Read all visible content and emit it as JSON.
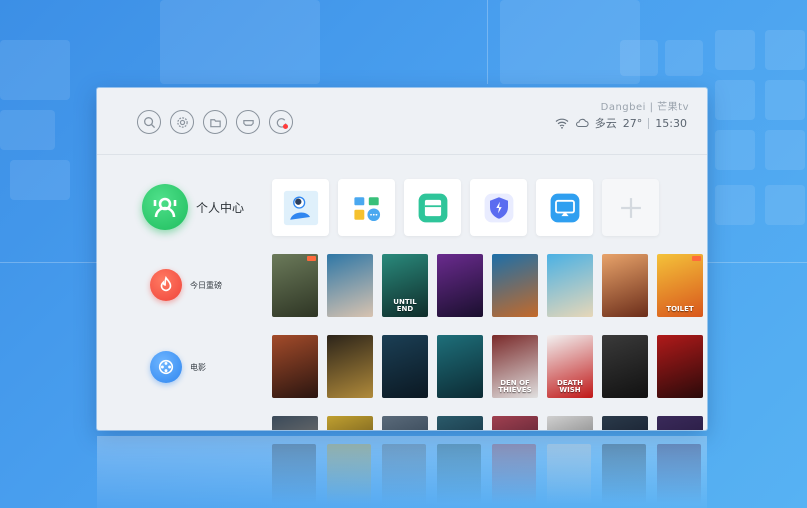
{
  "header": {
    "brand": "Dangbei | 芒果tv",
    "weather_text": "多云",
    "temperature": "27°",
    "time": "15:30"
  },
  "toolbar": {
    "icons": [
      "search-icon",
      "settings-icon",
      "folder-icon",
      "hdmi-icon",
      "record-icon"
    ]
  },
  "sidebar": {
    "user": {
      "label": "个人中心"
    },
    "items": [
      {
        "label": "今日重磅"
      },
      {
        "label": "电影"
      }
    ]
  },
  "apps": [
    {
      "name": "user-app",
      "icon": "person-icon"
    },
    {
      "name": "app-folder",
      "icon": "grid-icon"
    },
    {
      "name": "file-manager",
      "icon": "folder-green-icon"
    },
    {
      "name": "security",
      "icon": "shield-icon"
    },
    {
      "name": "screen-cast",
      "icon": "cast-icon"
    },
    {
      "name": "add-app",
      "icon": "plus-icon"
    }
  ],
  "posters": {
    "row1": [
      {
        "title": "",
        "colors": [
          "#6b7a5a",
          "#2e3524"
        ]
      },
      {
        "title": "",
        "colors": [
          "#2f77a6",
          "#d8c3b0"
        ]
      },
      {
        "title": "UNTIL END",
        "colors": [
          "#2a8a7c",
          "#0f2c2a"
        ]
      },
      {
        "title": "",
        "colors": [
          "#6a2b8e",
          "#1a0f2e"
        ]
      },
      {
        "title": "",
        "colors": [
          "#1d6fa8",
          "#c46a2a"
        ]
      },
      {
        "title": "",
        "colors": [
          "#4bb1e4",
          "#e7d7b8"
        ]
      },
      {
        "title": "",
        "colors": [
          "#e8a36a",
          "#6b2d1a"
        ]
      },
      {
        "title": "TOILET",
        "colors": [
          "#f4c23a",
          "#d8561c"
        ]
      }
    ],
    "row2": [
      {
        "title": "",
        "colors": [
          "#a34b2a",
          "#2a1510"
        ]
      },
      {
        "title": "",
        "colors": [
          "#2c241a",
          "#b08a3a"
        ]
      },
      {
        "title": "",
        "colors": [
          "#1b3f55",
          "#0b1822"
        ]
      },
      {
        "title": "",
        "colors": [
          "#1e6f7a",
          "#0c2a33"
        ]
      },
      {
        "title": "DEN OF THIEVES",
        "colors": [
          "#7a2a2a",
          "#e0e0e0"
        ]
      },
      {
        "title": "DEATH WISH",
        "colors": [
          "#f2f2f2",
          "#c01818"
        ]
      },
      {
        "title": "",
        "colors": [
          "#3a3a3a",
          "#111111"
        ]
      },
      {
        "title": "",
        "colors": [
          "#b01a1a",
          "#2a0a0a"
        ]
      }
    ],
    "row3": [
      {
        "title": "",
        "colors": [
          "#3a4a5a",
          "#9a8a7a"
        ]
      },
      {
        "title": "",
        "colors": [
          "#c0a030",
          "#3a2a10"
        ]
      },
      {
        "title": "",
        "colors": [
          "#5a6a7a",
          "#1a2a3a"
        ]
      },
      {
        "title": "",
        "colors": [
          "#2a5a6a",
          "#0a1a2a"
        ]
      },
      {
        "title": "",
        "colors": [
          "#a04050",
          "#2a1020"
        ]
      },
      {
        "title": "",
        "colors": [
          "#d0d0d0",
          "#4a4a4a"
        ]
      },
      {
        "title": "",
        "colors": [
          "#2a3a4a",
          "#0a0a1a"
        ]
      },
      {
        "title": "",
        "colors": [
          "#3a2a5a",
          "#1a1030"
        ]
      }
    ]
  },
  "colors": {
    "accent_green": "#1fbd5e",
    "accent_red": "#f0443b",
    "accent_blue": "#2f86f0",
    "background": "#3c8fe6"
  }
}
